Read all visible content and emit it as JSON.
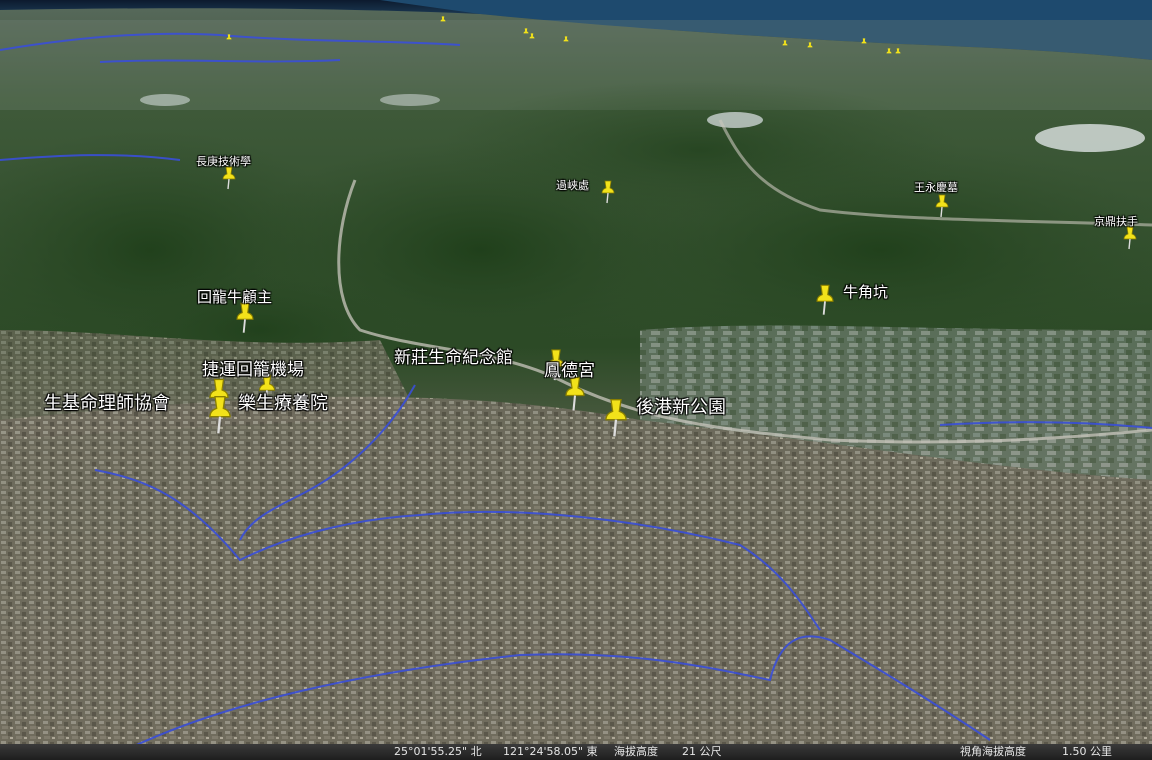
{
  "map": {
    "placemarks": [
      {
        "id": "changgung",
        "label": "長庚技術學",
        "size": "xs"
      },
      {
        "id": "guoxiachu",
        "label": "過峽處",
        "size": "xs"
      },
      {
        "id": "wangyongqing",
        "label": "王永慶墓",
        "size": "xs"
      },
      {
        "id": "jingding",
        "label": "京鼎扶手",
        "size": "xs"
      },
      {
        "id": "niujiaokeng",
        "label": "牛角坑",
        "size": "sm"
      },
      {
        "id": "huilong-niuguzhu",
        "label": "回龍牛顧主",
        "size": "sm"
      },
      {
        "id": "jieyun-huilong",
        "label": "捷運回籠機場",
        "size": "md"
      },
      {
        "id": "shengji",
        "label": "生基命理師協會",
        "size": "lg"
      },
      {
        "id": "lesheng",
        "label": "樂生療養院",
        "size": "lg"
      },
      {
        "id": "xinzhuang-memorial",
        "label": "新莊生命紀念館",
        "size": "md"
      },
      {
        "id": "fengde",
        "label": "鳳德宮",
        "size": "md"
      },
      {
        "id": "hougang",
        "label": "後港新公園",
        "size": "lg"
      }
    ]
  },
  "statusbar": {
    "latitude": "25°01'55.25\" 北",
    "longitude": "121°24'58.05\" 東",
    "elevation_label": "海拔高度",
    "elevation_value": "21 公尺",
    "eye_alt_label": "視角海拔高度",
    "eye_alt_value": "1.50 公里"
  },
  "colors": {
    "pin": "#f2e21a",
    "river": "#3a4fd8",
    "sea": "#1e4a6e"
  }
}
